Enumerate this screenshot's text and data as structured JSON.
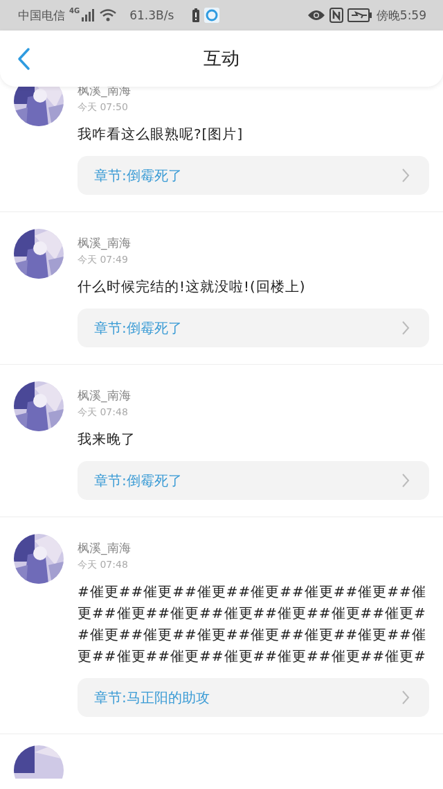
{
  "status_bar": {
    "carrier": "中国电信",
    "network": "4G",
    "speed": "61.3B/s",
    "time": "傍晚5:59"
  },
  "header": {
    "title": "互动"
  },
  "comments": [
    {
      "user": "枫溪_南海",
      "time": "今天 07:50",
      "text": "我咋看这么眼熟呢?[图片]",
      "chapter": "章节:倒霉死了"
    },
    {
      "user": "枫溪_南海",
      "time": "今天 07:49",
      "text": "什么时候完结的!这就没啦!(回楼上)",
      "chapter": "章节:倒霉死了"
    },
    {
      "user": "枫溪_南海",
      "time": "今天 07:48",
      "text": "我来晚了",
      "chapter": "章节:倒霉死了"
    },
    {
      "user": "枫溪_南海",
      "time": "今天 07:48",
      "text": "#催更##催更##催更##催更##催更##催更##催更##催更##催更##催更##催更##催更##催更##催更##催更##催更##催更##催更##催更##催更##催更##催更##催更##催更##催更##催更#",
      "chapter": "章节:马正阳的助攻"
    }
  ]
}
